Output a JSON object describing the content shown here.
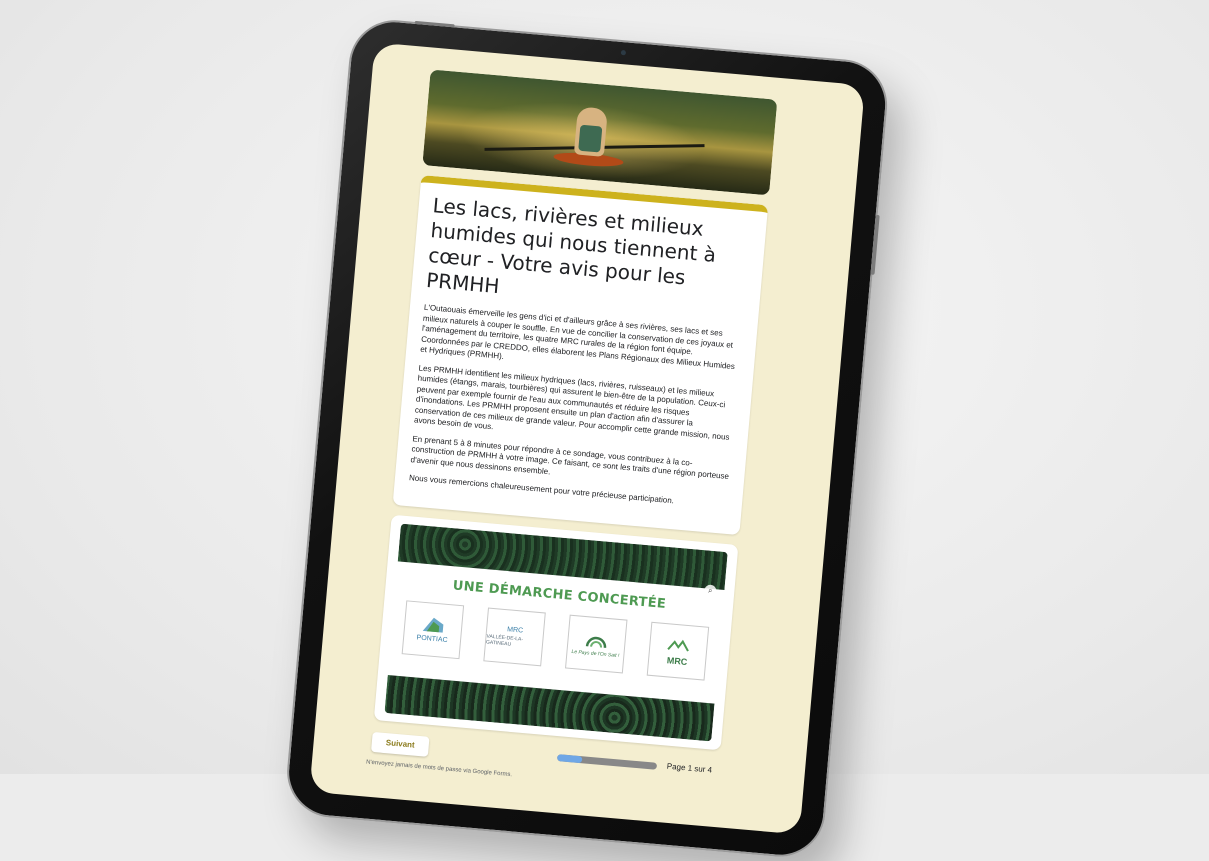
{
  "form": {
    "title": "Les lacs, rivières et milieux humides qui nous tiennent à cœur - Votre avis pour les PRMHH",
    "description": [
      "L'Outaouais émerveille les gens d'ici et d'ailleurs grâce à ses rivières, ses lacs et ses milieux naturels à couper le souffle. En vue de concilier la conservation de ces joyaux et l'aménagement du territoire, les quatre MRC rurales de la région font équipe. Coordonnées par le CREDDO, elles élaborent les Plans Régionaux des Milieux Humides et Hydriques (PRMHH).",
      "Les PRMHH identifient les milieux hydriques (lacs, rivières, ruisseaux) et les milieux humides (étangs, marais, tourbières) qui assurent le bien-être de la population. Ceux-ci peuvent par exemple fournir de l'eau aux communautés et réduire les risques d'inondations. Les PRMHH proposent ensuite un plan d'action afin d'assurer la conservation de ces milieux de grande valeur. Pour accomplir cette grande mission, nous avons besoin de vous.",
      "En prenant 5 à 8 minutes pour répondre à ce sondage, vous contribuez à la co-construction de PRMHH à votre image. Ce faisant, ce sont les traits d'une région porteuse d'avenir que nous dessinons ensemble.",
      "Nous vous remercions chaleureusement pour votre précieuse participation."
    ],
    "accent_color": "#cdb21d",
    "background_color": "#f4eed0"
  },
  "concerted": {
    "heading": "UNE DÉMARCHE CONCERTÉE",
    "logos": [
      {
        "name": "pontiac-logo",
        "text": "PONTIAC"
      },
      {
        "name": "mrc-vallee-gatineau-logo",
        "text": "MRC",
        "subtext": "VALLÉE-DE-LA-GATINEAU"
      },
      {
        "name": "mrc-papineau-logo",
        "text": "",
        "subtext": "Le Pays de l'On Sait !"
      },
      {
        "name": "mrc-collines-logo",
        "text": "MRC"
      }
    ]
  },
  "footer": {
    "next_label": "Suivant",
    "page_label": "Page 1 sur 4",
    "progress": 0.25,
    "password_note": "N'envoyez jamais de mots de passe via Google Forms."
  }
}
